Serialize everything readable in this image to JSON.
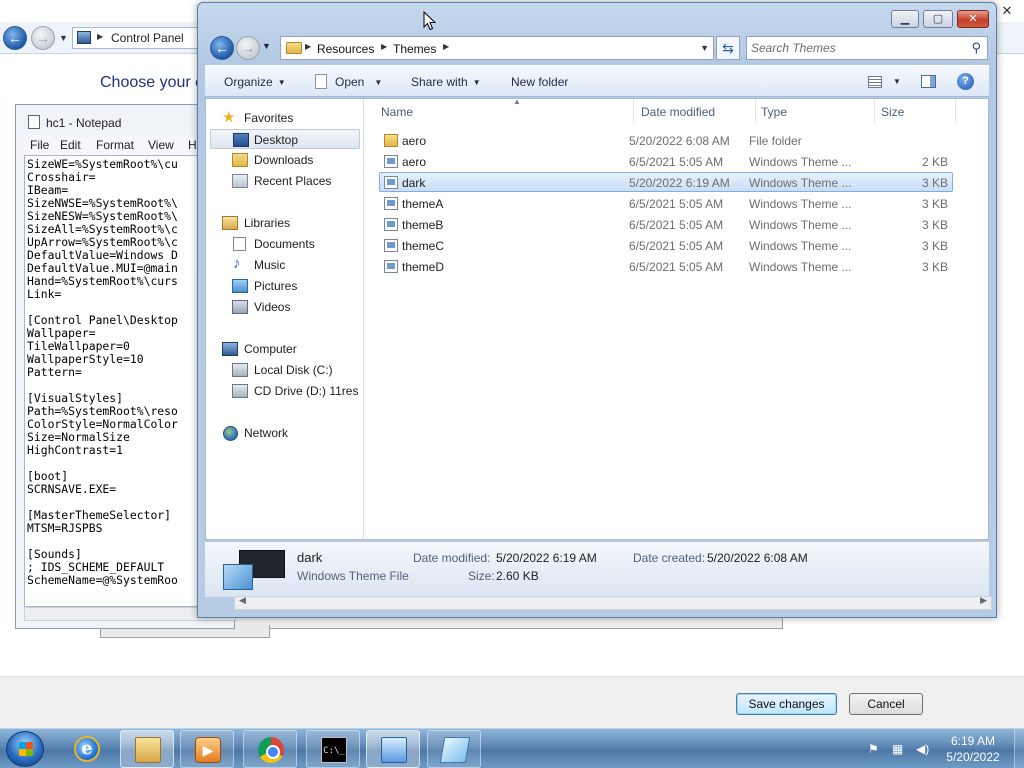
{
  "control_panel": {
    "address": "Control Panel",
    "heading": "Choose your c",
    "save_label": "Save changes",
    "cancel_label": "Cancel"
  },
  "notepad": {
    "title": "hc1 - Notepad",
    "menus": [
      "File",
      "Edit",
      "Format",
      "View",
      "H"
    ],
    "lines": [
      "SizeWE=%SystemRoot%\\cu",
      "Crosshair=",
      "IBeam=",
      "SizeNWSE=%SystemRoot%\\",
      "SizeNESW=%SystemRoot%\\",
      "SizeAll=%SystemRoot%\\c",
      "UpArrow=%SystemRoot%\\c",
      "DefaultValue=Windows D",
      "DefaultValue.MUI=@main",
      "Hand=%SystemRoot%\\curs",
      "Link=",
      "",
      "[Control Panel\\Desktop",
      "Wallpaper=",
      "TileWallpaper=0",
      "WallpaperStyle=10",
      "Pattern=",
      "",
      "[VisualStyles]",
      "Path=%SystemRoot%\\reso",
      "ColorStyle=NormalColor",
      "Size=NormalSize",
      "HighContrast=1",
      "",
      "[boot]",
      "SCRNSAVE.EXE=",
      "",
      "[MasterThemeSelector]",
      "MTSM=RJSPBS",
      "",
      "[Sounds]",
      "; IDS_SCHEME_DEFAULT",
      "SchemeName=@%SystemRoo"
    ]
  },
  "explorer": {
    "breadcrumb": [
      "Resources",
      "Themes"
    ],
    "search_placeholder": "Search Themes",
    "toolbar": {
      "organize": "Organize",
      "open": "Open",
      "share": "Share with",
      "new_folder": "New folder"
    },
    "nav": {
      "favorites": "Favorites",
      "desktop": "Desktop",
      "downloads": "Downloads",
      "recent": "Recent Places",
      "libraries": "Libraries",
      "documents": "Documents",
      "music": "Music",
      "pictures": "Pictures",
      "videos": "Videos",
      "computer": "Computer",
      "local_disk": "Local Disk (C:)",
      "cd_drive": "CD Drive (D:) 11res",
      "network": "Network"
    },
    "columns": {
      "name": "Name",
      "date": "Date modified",
      "type": "Type",
      "size": "Size"
    },
    "files": [
      {
        "name": "aero",
        "date": "5/20/2022 6:08 AM",
        "type": "File folder",
        "size": ""
      },
      {
        "name": "aero",
        "date": "6/5/2021 5:05 AM",
        "type": "Windows Theme ...",
        "size": "2 KB"
      },
      {
        "name": "dark",
        "date": "5/20/2022 6:19 AM",
        "type": "Windows Theme ...",
        "size": "3 KB"
      },
      {
        "name": "themeA",
        "date": "6/5/2021 5:05 AM",
        "type": "Windows Theme ...",
        "size": "3 KB"
      },
      {
        "name": "themeB",
        "date": "6/5/2021 5:05 AM",
        "type": "Windows Theme ...",
        "size": "3 KB"
      },
      {
        "name": "themeC",
        "date": "6/5/2021 5:05 AM",
        "type": "Windows Theme ...",
        "size": "3 KB"
      },
      {
        "name": "themeD",
        "date": "6/5/2021 5:05 AM",
        "type": "Windows Theme ...",
        "size": "3 KB"
      }
    ],
    "details": {
      "name": "dark",
      "kind": "Windows Theme File",
      "modified_label": "Date modified:",
      "modified_value": "5/20/2022 6:19 AM",
      "created_label": "Date created:",
      "created_value": "5/20/2022 6:08 AM",
      "size_label": "Size:",
      "size_value": "2.60 KB"
    }
  },
  "taskbar": {
    "time": "6:19 AM",
    "date": "5/20/2022"
  }
}
